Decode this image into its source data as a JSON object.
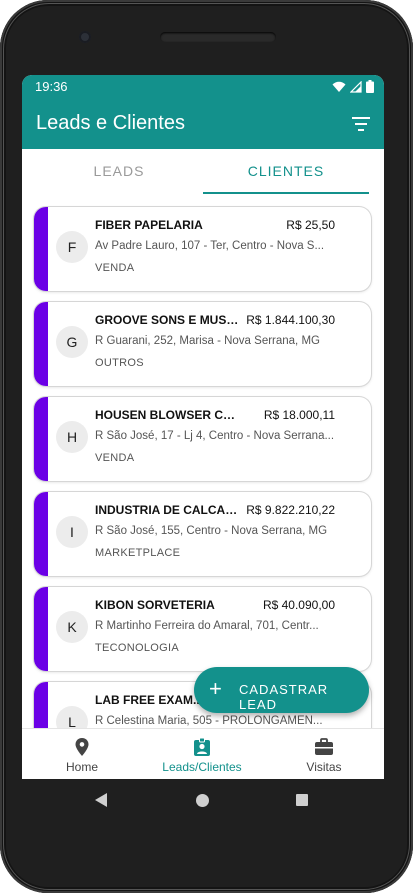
{
  "status_bar": {
    "time": "19:36"
  },
  "app_bar": {
    "title": "Leads e Clientes"
  },
  "tabs": [
    {
      "label": "LEADS",
      "active": false
    },
    {
      "label": "CLIENTES",
      "active": true
    }
  ],
  "clients": [
    {
      "initial": "F",
      "name": "FIBER PAPELARIA",
      "value": "R$ 25,50",
      "address": "Av Padre Lauro, 107 - Ter, Centro - Nova S...",
      "category": "VENDA"
    },
    {
      "initial": "G",
      "name": "GROOVE SONS E MUSIC...",
      "value": "R$ 1.844.100,30",
      "address": "R Guarani, 252, Marisa - Nova Serrana, MG",
      "category": "OUTROS"
    },
    {
      "initial": "H",
      "name": "HOUSEN BLOWSER COMER...",
      "value": "R$ 18.000,11",
      "address": "R São José, 17 - Lj 4, Centro - Nova Serrana...",
      "category": "VENDA"
    },
    {
      "initial": "I",
      "name": "INDUSTRIA DE CALCAD...",
      "value": "R$ 9.822.210,22",
      "address": "R São José, 155, Centro - Nova Serrana, MG",
      "category": "MARKETPLACE"
    },
    {
      "initial": "K",
      "name": "KIBON SORVETERIA",
      "value": "R$ 40.090,00",
      "address": "R Martinho Ferreira do Amaral, 701, Centr...",
      "category": "TECONOLOGIA"
    },
    {
      "initial": "L",
      "name": "LAB FREE EXAM...",
      "value": "",
      "address": "R Celestina Maria, 505 - PROLONGAMEN...",
      "category": ""
    }
  ],
  "fab": {
    "label": "CADASTRAR LEAD"
  },
  "bottom_nav": [
    {
      "label": "Home",
      "icon": "location-pin-icon",
      "active": false
    },
    {
      "label": "Leads/Clientes",
      "icon": "contact-badge-icon",
      "active": true
    },
    {
      "label": "Visitas",
      "icon": "briefcase-icon",
      "active": false
    }
  ],
  "colors": {
    "primary": "#13918c",
    "stripe": "#6b00e6"
  }
}
